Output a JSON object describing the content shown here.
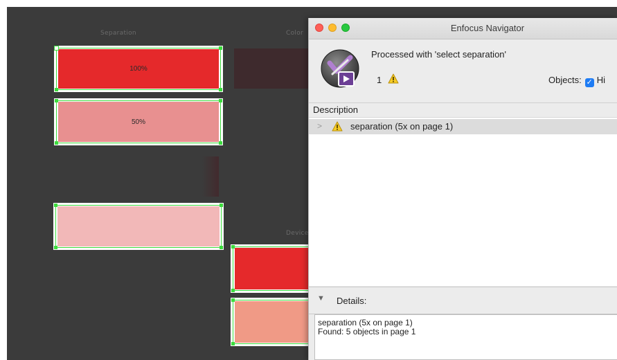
{
  "canvas": {
    "labels": {
      "col1": "Separation",
      "col2": "Color",
      "device": "Device"
    },
    "swatches": {
      "s1": {
        "label": "100%",
        "color": "#e5292b"
      },
      "s2": {
        "label": "50%",
        "color": "#e89090"
      },
      "s3": {
        "label": "",
        "color": "#f2b8b8"
      },
      "s4": {
        "label": "",
        "color": "#e5292b"
      },
      "s5": {
        "label": "",
        "color": "#f09a86"
      }
    },
    "selection_color": "#3ddc3d"
  },
  "navigator": {
    "title": "Enfocus Navigator",
    "processed": "Processed with 'select separation'",
    "warning_count": "1",
    "objects_label": "Objects:",
    "objects_option": "Hi",
    "description_header": "Description",
    "rows": [
      {
        "text": "separation (5x on page 1)",
        "icon": "warning-icon"
      }
    ],
    "details_label": "Details:",
    "details_lines": [
      "separation (5x on page 1)",
      "Found: 5 objects in page 1"
    ]
  }
}
